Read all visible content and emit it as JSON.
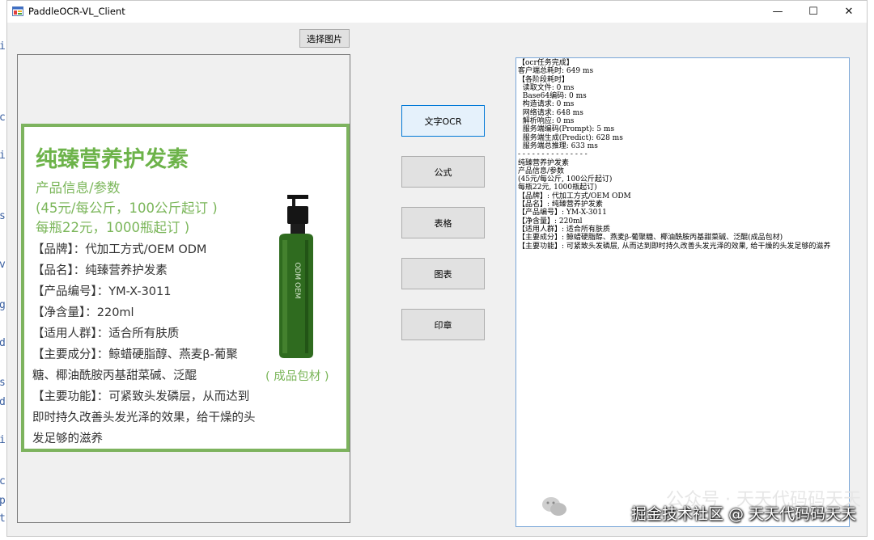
{
  "window": {
    "title": "PaddleOCR-VL_Client",
    "minimize": "—",
    "maximize": "☐",
    "close": "✕"
  },
  "toolbar": {
    "select_image_label": "选择图片"
  },
  "actions": [
    {
      "label": "文字OCR",
      "active": true
    },
    {
      "label": "公式",
      "active": false
    },
    {
      "label": "表格",
      "active": false
    },
    {
      "label": "图表",
      "active": false
    },
    {
      "label": "印章",
      "active": false
    }
  ],
  "product_image": {
    "title": "纯臻营养护发素",
    "sub1": "产品信息/参数",
    "sub2": "(45元/每公斤，100公斤起订 )",
    "sub3": "每瓶22元，1000瓶起订 )",
    "lines": [
      "【品牌】：代加工方式/OEM ODM",
      "【品名】：纯臻营养护发素",
      "【产品编号】：YM-X-3011",
      "【净含量】：220ml",
      "【适用人群】：适合所有肤质",
      "【主要成分】：鲸蜡硬脂醇、燕麦β-葡聚",
      "糖、椰油酰胺丙基甜菜碱、泛醌",
      "【主要功能】：可紧致头发磷层，从而达到",
      "即时持久改善头发光泽的效果，给干燥的头",
      "发足够的滋养"
    ],
    "pack_note": "( 成品包材 )",
    "bottle_label": "ODM OEM"
  },
  "result": {
    "lines": [
      "【ocr任务完成】",
      "客户端总耗时: 649 ms",
      "【各阶段耗时】",
      "  读取文件: 0 ms",
      "  Base64编码: 0 ms",
      "  构造请求: 0 ms",
      "  网络请求: 648 ms",
      "  解析响应: 0 ms",
      "  服务端编码(Prompt): 5 ms",
      "  服务端生成(Predict): 628 ms",
      "  服务端总推理: 633 ms",
      "- - - - - - - - - - - - - - -",
      "纯臻营养护发素",
      "产品信息/参数",
      "(45元/每公斤, 100公斤起订)",
      "每瓶22元, 1000瓶起订)",
      "【品牌】: 代加工方式/OEM ODM",
      "【品名】: 纯臻营养护发素",
      "【产品编号】: YM-X-3011",
      "【净含量】: 220ml",
      "【适用人群】: 适合所有肤质",
      "【主要成分】: 鲸蜡硬脂醇、燕麦β-葡聚糖、椰油酰胺丙基甜菜碱、泛醌(成品包材)",
      "【主要功能】: 可紧致头发磷层, 从而达到即时持久改善头发光泽的效果, 给干燥的头发足够的滋养"
    ]
  },
  "watermark": {
    "line1": "公众号 · 天天代码码天天",
    "line2": "掘金技术社区 @ 天天代码码天天"
  },
  "background_editor_chars": [
    "i",
    "c",
    "i",
    "s",
    "v",
    "g",
    "d",
    "s",
    "d",
    "i",
    "c",
    "p",
    "t"
  ]
}
